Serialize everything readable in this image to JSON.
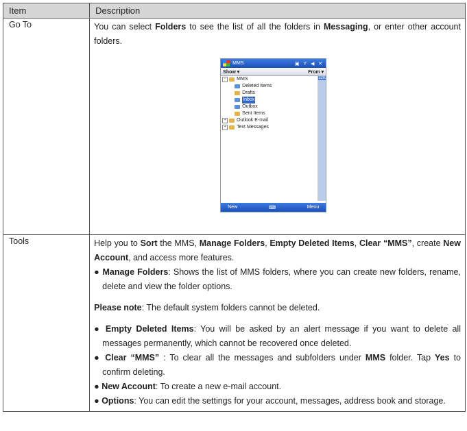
{
  "header": {
    "item": "Item",
    "description": "Description"
  },
  "goto": {
    "item": "Go To",
    "d1": "You can select ",
    "b1": "Folders",
    "d2": " to see the list of all the folders in ",
    "b2": "Messaging",
    "d3": ", or enter other account folders."
  },
  "phone": {
    "title": "MMS",
    "status": "▣ Y ◀ ✕",
    "show": "Show ▾",
    "from": "From ▾",
    "side_label": "32K",
    "tree": [
      "MMS",
      "Deleted Items",
      "Drafts",
      "Inbox",
      "Outbox",
      "Sent Items",
      "Outlook E-mail",
      "Text Messages"
    ],
    "new": "New",
    "menu": "Menu",
    "kbd": "⌨"
  },
  "tools": {
    "item": "Tools",
    "p1a": "Help you to ",
    "p1b": "Sort",
    "p1c": " the MMS, ",
    "p1d": "Manage Folders",
    "p1e": ", ",
    "p1f": "Empty Deleted Items",
    "p1g": ", ",
    "p1h": "Clear “MMS”",
    "p1i": ", create ",
    "p1j": "New Account",
    "p1k": ", and access more features.",
    "b1a": "● ",
    "b1b": "Manage Folders",
    "b1c": ": Shows the list of MMS folders, where you can create new folders, rename, delete and view the folder options.",
    "note_b": "Please note",
    "note_t": ": The default system folders cannot be deleted.",
    "b2b": "Empty Deleted Items",
    "b2c": ": You will be asked by an alert message if you want to delete all messages permanently, which cannot be recovered once deleted.",
    "b3b": "Clear “MMS”",
    "b3c": " : To clear all the messages and subfolders under ",
    "b3d": "MMS",
    "b3e": " folder. Tap ",
    "b3f": "Yes",
    "b3g": " to confirm deleting.",
    "b4b": "New Account",
    "b4c": ": To create a new e-mail account.",
    "b5b": "Options",
    "b5c": ": You can edit the settings for your account, messages, address book and storage."
  }
}
